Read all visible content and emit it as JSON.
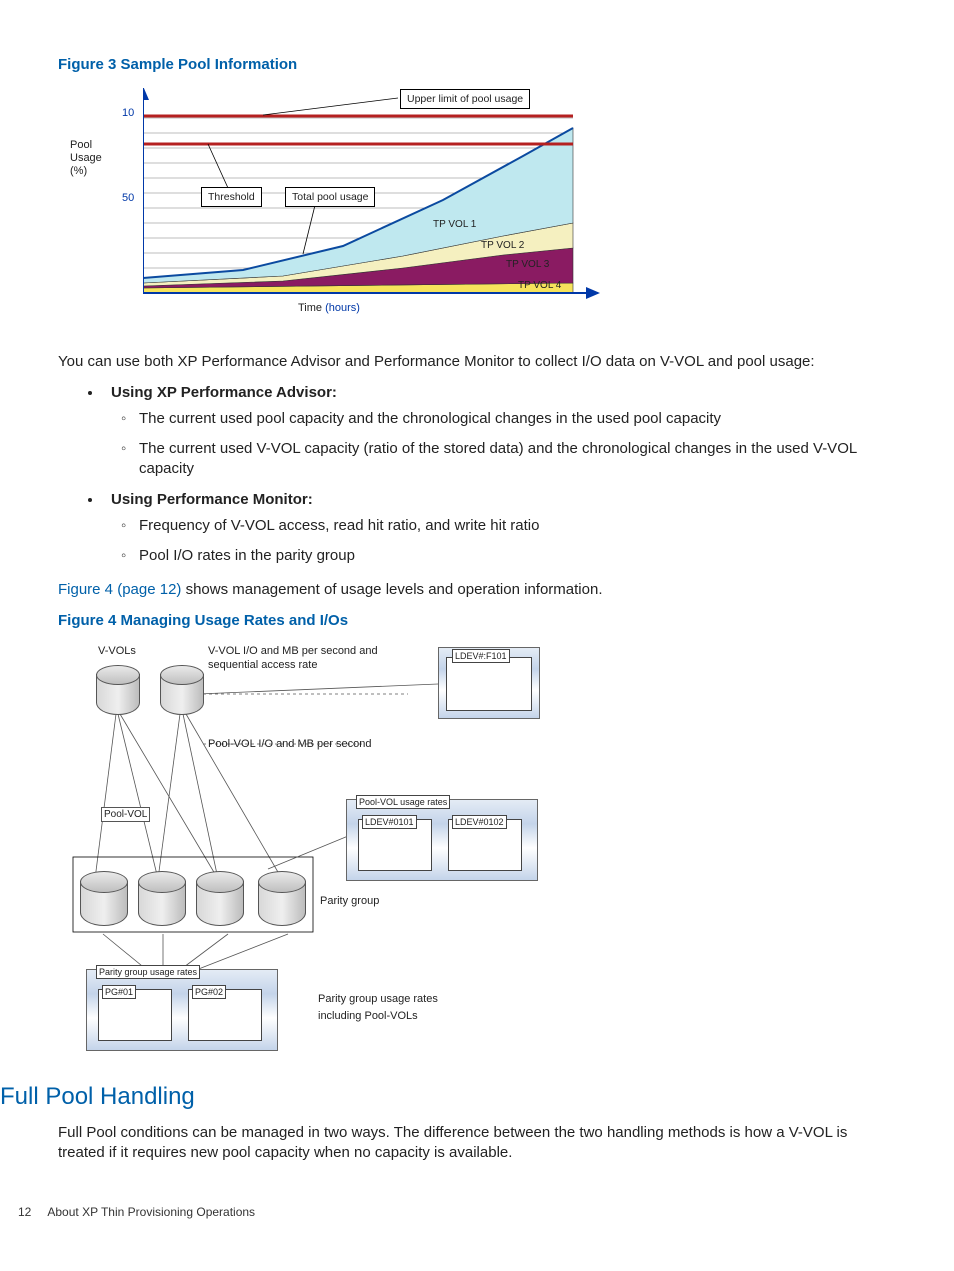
{
  "figure3": {
    "title": "Figure 3 Sample Pool Information",
    "yaxis_title": "Pool\nUsage\n(%)",
    "ytick_top": "10",
    "ytick_mid": "50",
    "xaxis_label": "Time",
    "xaxis_unit": "(hours)",
    "callouts": {
      "upper_limit": "Upper limit of pool usage",
      "threshold": "Threshold",
      "total_pool": "Total pool usage"
    },
    "series_labels": {
      "v1": "TP VOL 1",
      "v2": "TP VOL 2",
      "v3": "TP VOL 3",
      "v4": "TP VOL 4"
    }
  },
  "intro_para": "You can use both XP Performance Advisor and Performance Monitor to collect I/O data on V-VOL and pool usage:",
  "lists": {
    "pa_title": "Using XP Performance Advisor:",
    "pa_items": [
      "The current used pool capacity and the chronological changes in the used pool capacity",
      "The current used V-VOL capacity (ratio of the stored data) and the chronological changes in the used V-VOL capacity"
    ],
    "pm_title": "Using Performance Monitor:",
    "pm_items": [
      "Frequency of V-VOL access, read hit ratio, and write hit ratio",
      "Pool I/O rates in the parity group"
    ]
  },
  "crossref": {
    "link": "Figure 4 (page 12)",
    "tail": " shows management of usage levels and operation information."
  },
  "figure4": {
    "title": "Figure 4 Managing Usage Rates and I/Os",
    "labels": {
      "vvols": "V-VOLs",
      "vvol_io": "V-VOL I/O and MB per second and\nsequential access rate",
      "pool_vol_io": "Pool-VOL I/O and MB per second",
      "pool_vol": "Pool-VOL",
      "parity_group": "Parity group",
      "pool_vol_rates": "Pool-VOL usage rates",
      "ldev1": "LDEV#0101",
      "ldev2": "LDEV#0102",
      "ldev_top": "LDEV#:F101",
      "pg_rates": "Parity group usage rates",
      "pg1": "PG#01",
      "pg2": "PG#02",
      "pg_rates_note": "Parity group usage rates\nincluding Pool-VOLs"
    }
  },
  "section_heading": "Full Pool Handling",
  "section_para": "Full Pool conditions can be managed in two ways. The difference between the two handling methods is how a V-VOL is treated if it requires new pool capacity when no capacity is available.",
  "footer": {
    "page": "12",
    "chapter": "About XP Thin Provisioning Operations"
  },
  "chart_data": [
    {
      "type": "area",
      "title": "Sample Pool Information",
      "xlabel": "Time (hours)",
      "ylabel": "Pool Usage (%)",
      "ylim": [
        0,
        100
      ],
      "reference_lines": [
        {
          "name": "Upper limit of pool usage",
          "value": 100
        },
        {
          "name": "Threshold",
          "value": 80
        }
      ],
      "note": "Stacked area chart showing cumulative pool capacity consumed by four thin-provisioning volumes over time; values estimated from figure.",
      "x": [
        0,
        1,
        2,
        3,
        4,
        5,
        6,
        7,
        8,
        9,
        10
      ],
      "series": [
        {
          "name": "TP VOL 4",
          "color": "#f6e35c",
          "values": [
            1,
            1,
            1,
            2,
            2,
            2,
            2,
            3,
            3,
            3,
            4
          ]
        },
        {
          "name": "TP VOL 3",
          "color": "#8a1b62",
          "values": [
            1,
            1,
            2,
            3,
            4,
            6,
            8,
            10,
            12,
            14,
            16
          ]
        },
        {
          "name": "TP VOL 2",
          "color": "#f5f0c0",
          "values": [
            2,
            2,
            3,
            4,
            5,
            6,
            8,
            10,
            12,
            14,
            16
          ]
        },
        {
          "name": "TP VOL 1",
          "color": "#bfe8ef",
          "values": [
            4,
            5,
            7,
            10,
            14,
            20,
            28,
            36,
            44,
            50,
            56
          ]
        }
      ],
      "total_pool_usage_approx": [
        8,
        9,
        13,
        19,
        25,
        34,
        46,
        59,
        71,
        81,
        92
      ]
    }
  ]
}
